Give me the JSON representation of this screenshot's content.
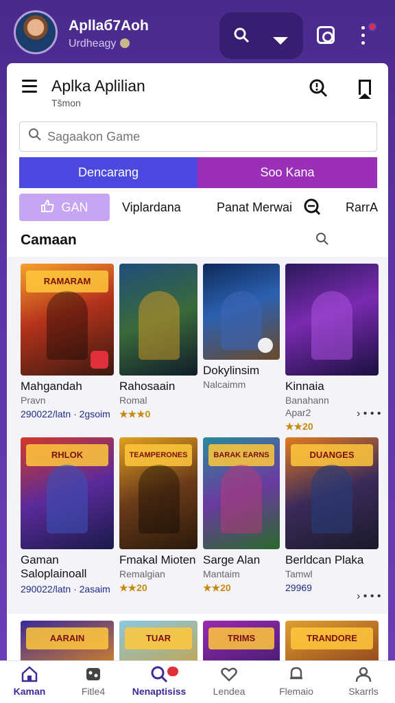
{
  "header": {
    "user_name": "Apllaб7Aoh",
    "user_status": "Urdheagy"
  },
  "app": {
    "title": "Aplka Aplilian",
    "subtitle": "Tšmon"
  },
  "search": {
    "placeholder": "Sagaakon Game"
  },
  "segments": {
    "left": "Dencarang",
    "right": "Soo Kana"
  },
  "chips": {
    "active": "GAN",
    "items": [
      "Viplardana",
      "Panat Merwai",
      "RarrA"
    ]
  },
  "section": {
    "title": "Camaan"
  },
  "games": [
    {
      "banner": "RAMARAM",
      "name": "Mahgandah",
      "meta": "Pravn",
      "stat": "290022/latn · 2gsoim",
      "stars": false
    },
    {
      "banner": "",
      "name": "Rahosaain",
      "meta": "Romal",
      "stat": "★★★0",
      "stars": true
    },
    {
      "banner": "",
      "name": "Dokylinsim",
      "meta": "Nalcaimm",
      "stat": "",
      "stars": false
    },
    {
      "banner": "",
      "name": "Kinnaia",
      "meta": "Banahann",
      "meta2": "Apar2",
      "stat": "★★20",
      "stars": true
    },
    {
      "banner": "RHLOK",
      "name": "Gaman",
      "name2": "Saloplainoall",
      "meta": "",
      "stat": "290022/latn · 2asaim",
      "stars": false
    },
    {
      "banner": "TEAMPERONES",
      "name": "Fmakal Mioten",
      "meta": "Remalgian",
      "stat": "★★20",
      "stars": true
    },
    {
      "banner": "BARAK EARNS",
      "name": "Sarge Alan",
      "meta": "Mantaim",
      "stat": "★★20",
      "stars": true
    },
    {
      "banner": "DUANGES",
      "name": "Berldcan Plaka",
      "meta": "Tamwl",
      "stat": "29969",
      "stars": false
    },
    {
      "banner": "AARAIN",
      "name": "",
      "meta": "",
      "stat": "",
      "stars": false
    },
    {
      "banner": "TUAR",
      "name": "",
      "meta": "",
      "stat": "",
      "stars": false
    },
    {
      "banner": "TRIMS",
      "name": "",
      "meta": "",
      "stat": "",
      "stars": false
    },
    {
      "banner": "TRANDORE",
      "name": "",
      "meta": "",
      "stat": "",
      "stars": false
    }
  ],
  "more_label": "› • • •",
  "nav": [
    {
      "label": "Kaman",
      "icon": "home-icon"
    },
    {
      "label": "Fitle4",
      "icon": "controller-icon"
    },
    {
      "label": "Nenaptisiss",
      "icon": "search-icon"
    },
    {
      "label": "Lendea",
      "icon": "heart-icon"
    },
    {
      "label": "Flemaio",
      "icon": "bell-icon"
    },
    {
      "label": "Skarrls",
      "icon": "profile-icon"
    }
  ],
  "colors": {
    "accent_blue": "#4d48e0",
    "accent_purple": "#9b2fb8",
    "chip_active": "#c6a6f2",
    "header_bg": "#5b34a8",
    "badge_red": "#e0303c"
  }
}
